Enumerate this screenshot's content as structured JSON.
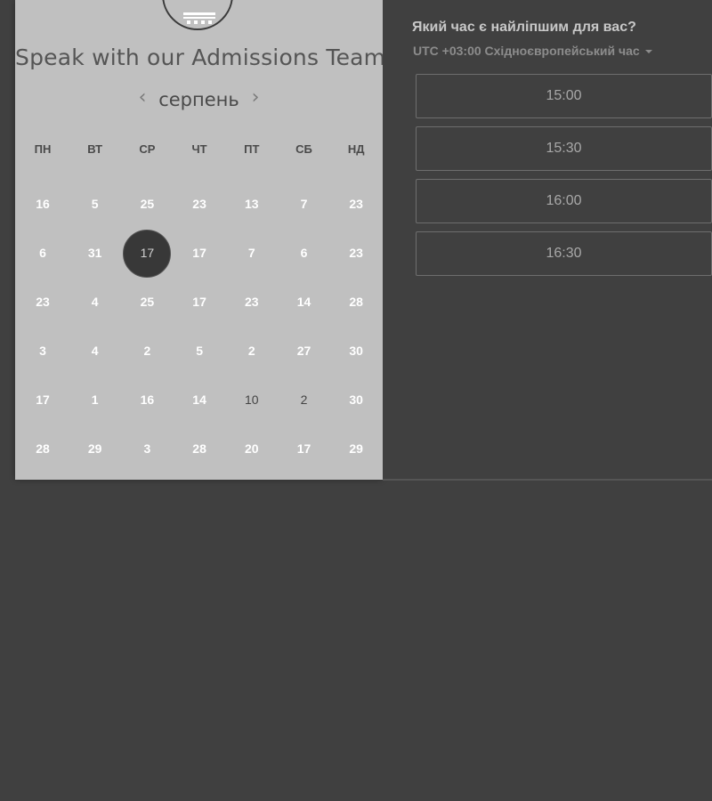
{
  "calendar": {
    "title": "Speak with our Admissions Team",
    "month": "серпень",
    "prev_arrow": "‹",
    "next_arrow": "›",
    "weekdays": [
      "ПН",
      "ВТ",
      "СР",
      "ЧТ",
      "ПТ",
      "СБ",
      "НД"
    ],
    "weeks": [
      [
        "16",
        "5",
        "25",
        "23",
        "13",
        "7",
        "23"
      ],
      [
        "6",
        "31",
        "17",
        "17",
        "7",
        "6",
        "23"
      ],
      [
        "23",
        "4",
        "25",
        "17",
        "23",
        "14",
        "28"
      ],
      [
        "3",
        "4",
        "2",
        "5",
        "2",
        "27",
        "30"
      ],
      [
        "17",
        "1",
        "16",
        "14",
        "10",
        "2",
        "30"
      ],
      [
        "28",
        "29",
        "3",
        "28",
        "20",
        "17",
        "29"
      ]
    ],
    "selected_day": "17",
    "muted_days": [
      "10",
      "2"
    ]
  },
  "booking": {
    "question": "Який час є найліпшим для вас?",
    "timezone": "UTC +03:00 Східноєвропейський час",
    "slots": [
      "15:00",
      "15:30",
      "16:00",
      "16:30"
    ]
  },
  "icons": {
    "logo": "school-crest-logo",
    "timezone_caret": "caret-down-icon"
  },
  "colors": {
    "page_background": "#404040",
    "calendar_background": "#c0c0c0",
    "selected_day": "#383838"
  }
}
